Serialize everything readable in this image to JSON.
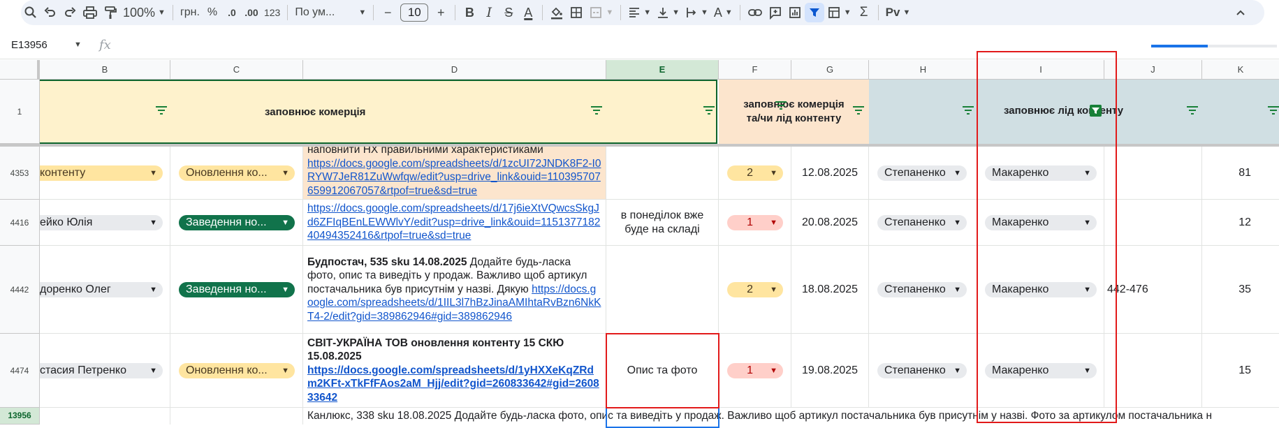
{
  "toolbar": {
    "zoom": "100%",
    "currency": "грн.",
    "percent": "%",
    "dec_decrease": ".0",
    "dec_increase": ".00",
    "number_format": "123",
    "font_family": "По ум...",
    "font_size": "10",
    "minus": "−",
    "plus": "+",
    "bold": "B",
    "italic": "I",
    "strike": "S",
    "text_color": "A",
    "rotate": "A",
    "sum": "Σ",
    "input_tools": "Рv"
  },
  "formula_bar": {
    "name_box": "E13956",
    "fx": "fx",
    "progress": 0.45
  },
  "columns": {
    "B": "B",
    "C": "C",
    "D": "D",
    "E": "E",
    "F": "F",
    "G": "G",
    "H": "H",
    "I": "I",
    "J": "J",
    "K": "K"
  },
  "header_row": {
    "row_num": "1",
    "commerce": "заповнює комерція",
    "commerce_lead": "заповнює комерція та/чи лід контенту",
    "lead_content": "заповнює лід контенту"
  },
  "rows": [
    {
      "num": "4353",
      "b": "контенту",
      "c": "Оновлення ко...",
      "d_text": "наповнити НХ правильними характеристиками ",
      "d_link": "https://docs.google.com/spreadsheets/d/1zcUI72JNDK8F2-I0RYW7JeR81ZuWwfqw/edit?usp=drive_link&ouid=110395707659912067057&rtpof=true&sd=true",
      "e": "",
      "f": "2",
      "g": "12.08.2025",
      "h": "Степаненко",
      "i": "Макаренко",
      "j": "",
      "k": "81"
    },
    {
      "num": "4416",
      "b": "ейко Юлія",
      "c": "Заведення но...",
      "d_text": "",
      "d_link": "https://docs.google.com/spreadsheets/d/17j6ieXtVQwcsSkgJd6ZFIqBEnLEWWlvY/edit?usp=drive_link&ouid=115137718240494352416&rtpof=true&sd=true",
      "e": "в понеділок вже буде на складі",
      "f": "1",
      "g": "20.08.2025",
      "h": "Степаненко",
      "i": "Макаренко",
      "j": "",
      "k": "12"
    },
    {
      "num": "4442",
      "b": "доренко Олег",
      "c": "Заведення но...",
      "d_bold": "Будпостач, 535 sku 14.08.2025",
      "d_text": " Додайте будь-ласка фото, опис та виведіть у продаж. Важливо щоб артикул постачальника був присутнім у назві. Дякую ",
      "d_link": "https://docs.google.com/spreadsheets/d/1IIL3l7hBzJinaAMIhtaRvBzn6NkKT4-2/edit?gid=389862946#gid=389862946",
      "e": "",
      "f": "2",
      "g": "18.08.2025",
      "h": "Степаненко",
      "i": "Макаренко",
      "j": "442-476",
      "k": "35"
    },
    {
      "num": "4474",
      "b": "стасия Петренко",
      "c": "Оновлення ко...",
      "d_bold": "СВІТ-УКРАЇНА ТОВ оновлення контенту 15 СКЮ 15.08.2025",
      "d_link": "https://docs.google.com/spreadsheets/d/1yHXXeKqZRdm2KFt-xTkFfFAos2aM_Hjj/edit?gid=260833642#gid=260833642",
      "e": "Опис та фото",
      "f": "1",
      "g": "19.08.2025",
      "h": "Степаненко",
      "i": "Макаренко",
      "j": "",
      "k": "15"
    }
  ],
  "last_row": {
    "num": "13956",
    "text": "Канлюкс, 338 sku 18.08.2025 Додайте будь-ласка фото, опис та виведіть у продаж. Важливо щоб артикул постачальника був присутнім у назві. Фото за артикулом постачальника н"
  },
  "colors": {
    "annotation_red": "#e21a1a",
    "selection_blue": "#1a73e8",
    "commerce_header": "#fef2cc",
    "mixed_header": "#fce5cd",
    "lead_header": "#d0dfe3"
  }
}
